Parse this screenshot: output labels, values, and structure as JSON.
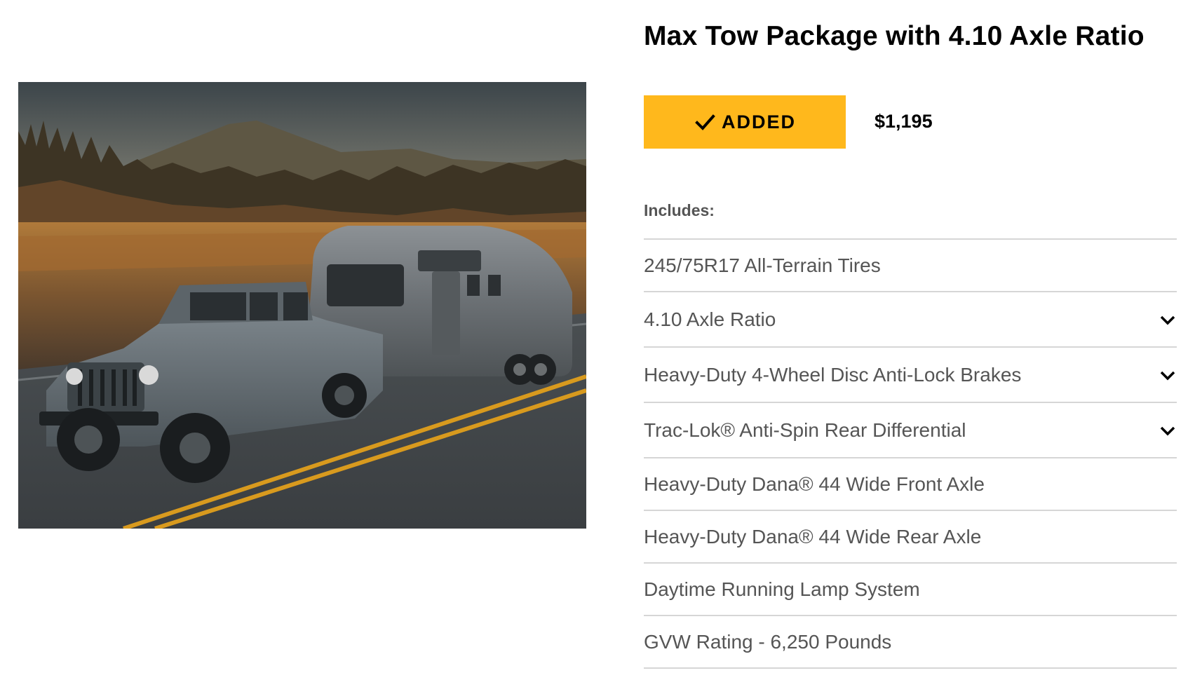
{
  "product": {
    "title": "Max Tow Package with 4.10 Axle Ratio",
    "image_alt": "Jeep Gladiator towing an Airstream trailer on a mountain road",
    "button": {
      "label": "ADDED",
      "icon": "check-icon",
      "state": "added"
    },
    "price": "$1,195",
    "includes_label": "Includes:",
    "items": [
      {
        "label": "245/75R17 All-Terrain Tires",
        "expandable": false
      },
      {
        "label": "4.10 Axle Ratio",
        "expandable": true
      },
      {
        "label": "Heavy-Duty 4-Wheel Disc Anti-Lock Brakes",
        "expandable": true
      },
      {
        "label": "Trac-Lok® Anti-Spin Rear Differential",
        "expandable": true
      },
      {
        "label": "Heavy-Duty Dana® 44 Wide Front Axle",
        "expandable": false
      },
      {
        "label": "Heavy-Duty Dana® 44 Wide Rear Axle",
        "expandable": false
      },
      {
        "label": "Daytime Running Lamp System",
        "expandable": false
      },
      {
        "label": "GVW Rating - 6,250 Pounds",
        "expandable": false
      }
    ]
  },
  "colors": {
    "accent": "#FFB81C",
    "title_text": "#000000",
    "body_text": "#555555",
    "divider": "#D6D6D6"
  }
}
